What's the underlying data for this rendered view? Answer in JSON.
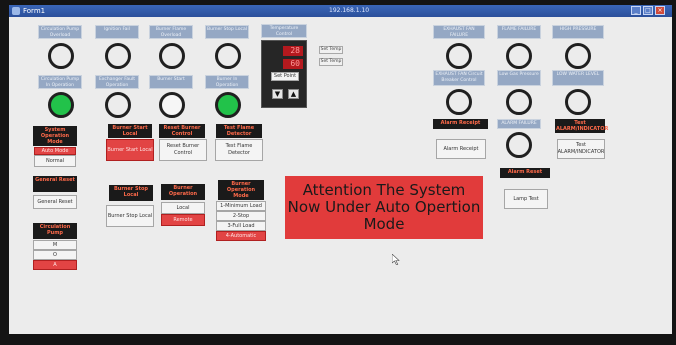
{
  "window": {
    "title": "Form1",
    "center_text": "192.168.1.10",
    "min": "_",
    "max": "□",
    "close": "×"
  },
  "lamps_top_row": {
    "labels": [
      "Circulation Pump Overload",
      "Ignition Fail",
      "Burner Flame Overload",
      "Burner Stop Local"
    ]
  },
  "lamps_second_row": {
    "labels": [
      "Circulation Pump In Operation",
      "Exchanger Fault Operation",
      "Burner Start",
      "Burner In Operation"
    ]
  },
  "temperature": {
    "label": "Temperature Control",
    "value1": "28",
    "value2": "60",
    "set_button": "Set Point",
    "up": "▼",
    "down": "▲",
    "side1": "Set Temp",
    "side2": "Set Temp"
  },
  "right_lamps": {
    "row1": [
      "EXHAUST FAN FAILURE",
      "FLAME FAILURE",
      "HIGH PRESSURE"
    ],
    "row2": [
      "EXHAUST FAN Circuit Breaker Control",
      "Low Gas Pressure",
      "LOW WATER LEVEL"
    ],
    "row3_label": "ALARM FAILURE"
  },
  "system_mode": {
    "header": "System Operation Mode",
    "auto": "Auto Mode",
    "normal": "Normal"
  },
  "burner_start_local": {
    "header": "Burner Start Local",
    "button": "Burner Start Local"
  },
  "reset_burner": {
    "header": "Reset Burner Control",
    "button": "Reset Burner Control"
  },
  "test_flame": {
    "header": "Test Flame Detector",
    "button": "Test Flame Detector"
  },
  "alarm_receipt": {
    "header": "Alarm Receipt",
    "button": "Alarm Receipt"
  },
  "test_panel": {
    "header": "Test ALARM/INDICATOR",
    "button": "Test ALARM/INDICATOR"
  },
  "alarm_reset": {
    "header": "Alarm Reset",
    "button": "Lamp Test"
  },
  "general_reset": {
    "header": "General Reset",
    "button": "General Reset"
  },
  "circulation_pump": {
    "header": "Circulation Pump",
    "m": "M",
    "o": "O",
    "a": "A"
  },
  "burner_stop_local": {
    "header": "Burner Stop Local",
    "button": "Burner Stop Local"
  },
  "burner_operation": {
    "header": "Burner Operation",
    "local": "Local",
    "remote": "Remote"
  },
  "burner_mode": {
    "header": "Burner Operation Mode",
    "options": [
      "1-Minimum Load",
      "2-Stop",
      "3-Full Load",
      "4-Automatic"
    ]
  },
  "message": "Attention The System Now Under Auto Opertion Mode",
  "colors": {
    "accent_red": "#e13b3b",
    "lamp_green": "#22c24a",
    "label_blue": "#95a8c4"
  }
}
